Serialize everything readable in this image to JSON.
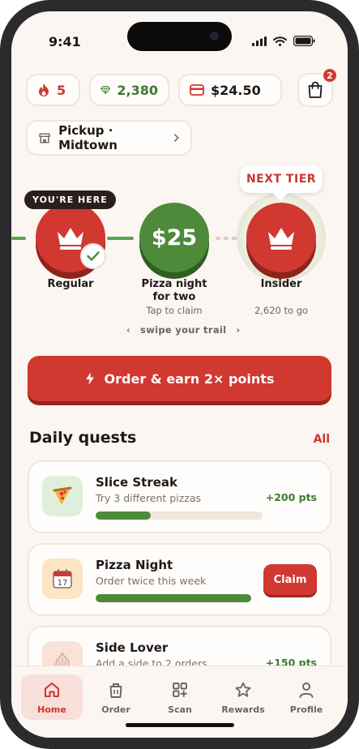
{
  "status_bar": {
    "time": "9:41"
  },
  "stats": {
    "streak": "5",
    "gems": "2,380",
    "balance": "$24.50"
  },
  "cart": {
    "count": "2"
  },
  "location": {
    "label": "Pickup · Midtown"
  },
  "trail": {
    "here_tag": "YOU'RE HERE",
    "next_tag": "NEXT TIER",
    "current": {
      "label": "Regular"
    },
    "reward": {
      "amount": "$25",
      "label": "Pizza night for two",
      "sub": "Tap to claim"
    },
    "next": {
      "label": "Insider",
      "sub": "2,620 to go"
    },
    "swipe_hint": "swipe your trail"
  },
  "cta": {
    "label": "Order & earn 2× points"
  },
  "quests_section": {
    "title": "Daily quests",
    "all_label": "All"
  },
  "quests": [
    {
      "title": "Slice Streak",
      "desc": "Try 3 different pizzas",
      "points": "+200 pts",
      "progress": 0.33,
      "icon": "pizza-slice-icon"
    },
    {
      "title": "Pizza Night",
      "desc": "Order twice this week",
      "action": "Claim",
      "progress": 1.0,
      "icon": "calendar-icon",
      "calendar_day": "17"
    },
    {
      "title": "Side Lover",
      "desc": "Add a side to 2 orders",
      "points": "+150 pts",
      "icon": "garlic-icon"
    }
  ],
  "tabs": [
    {
      "label": "Home",
      "icon": "home-icon",
      "active": true
    },
    {
      "label": "Order",
      "icon": "bag-icon",
      "active": false
    },
    {
      "label": "Scan",
      "icon": "scan-icon",
      "active": false
    },
    {
      "label": "Rewards",
      "icon": "star-icon",
      "active": false
    },
    {
      "label": "Profile",
      "icon": "person-icon",
      "active": false
    }
  ],
  "colors": {
    "brand_red": "#d1382f",
    "brand_green": "#4d8a3a",
    "background": "#fbf6f1",
    "dark": "#2a1f1a"
  }
}
